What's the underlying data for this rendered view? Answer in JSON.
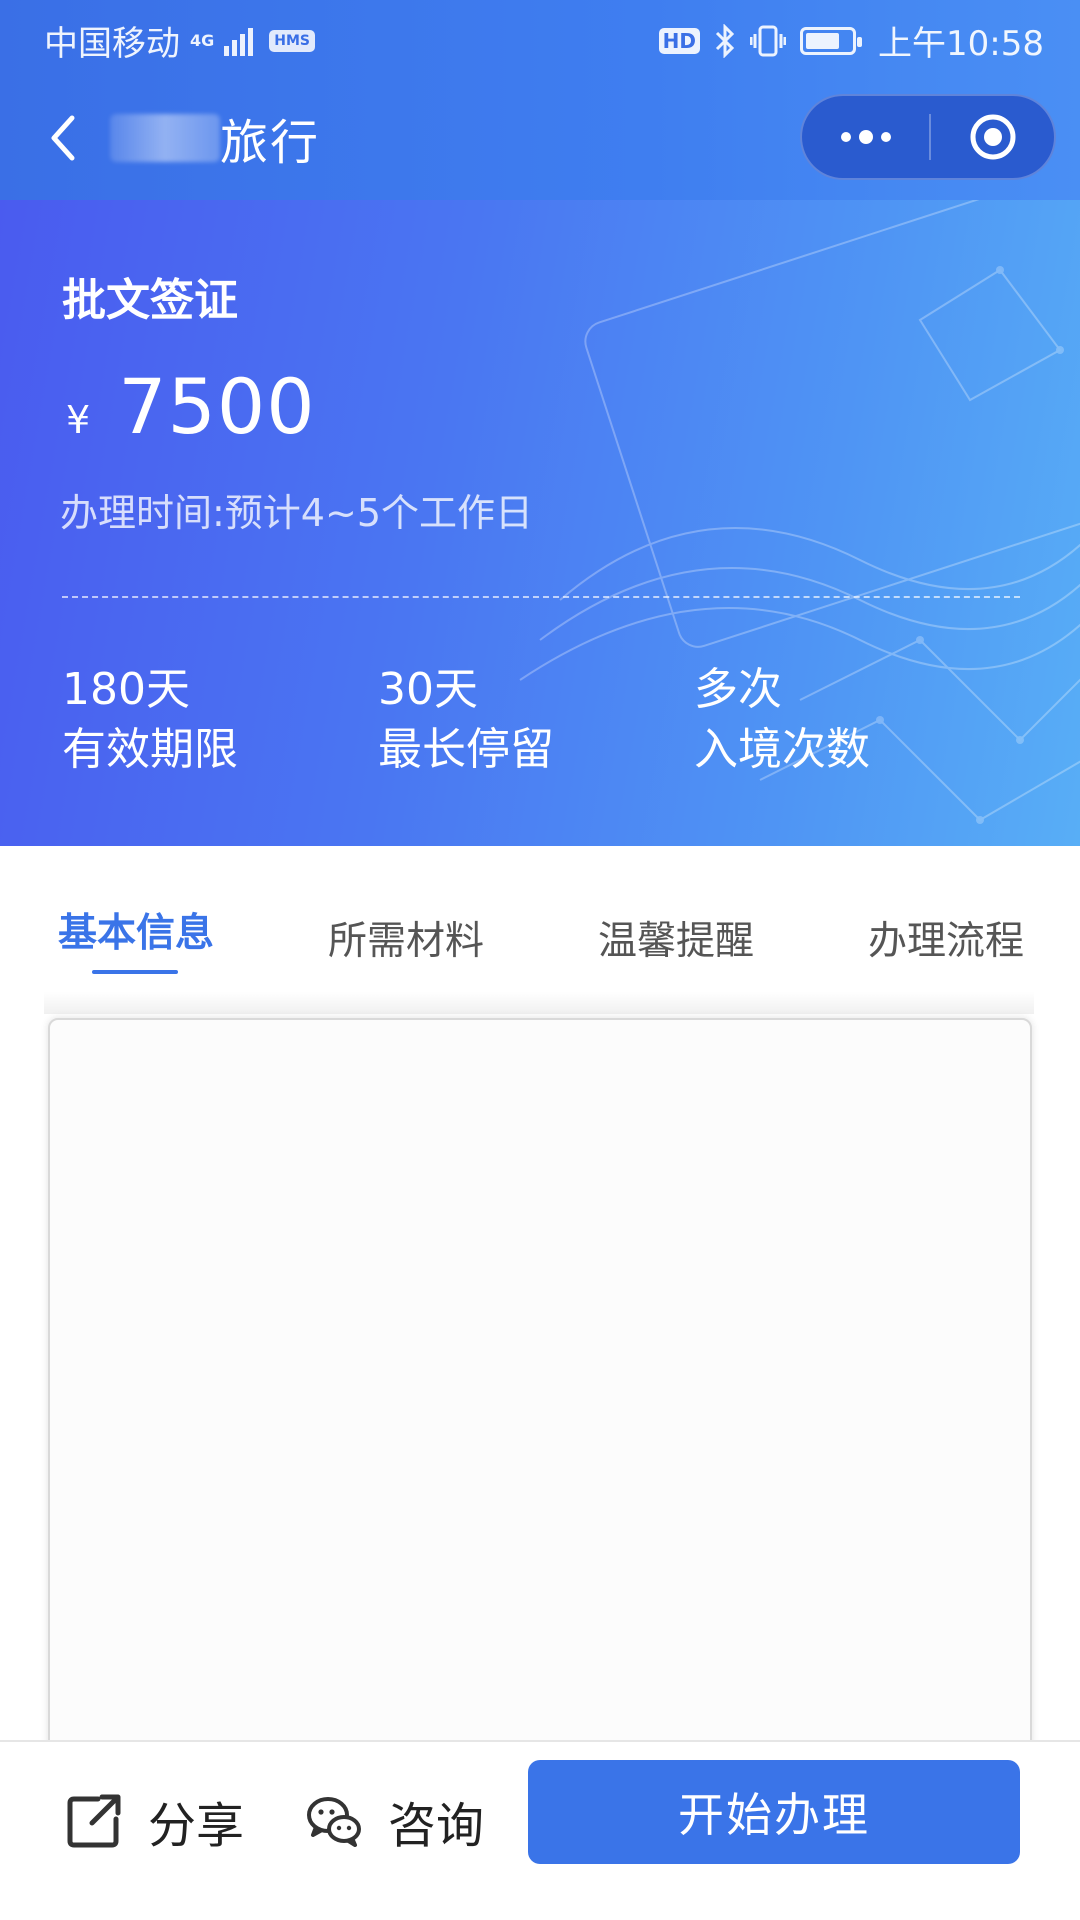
{
  "status_bar": {
    "carrier": "中国移动",
    "network": "4G",
    "hms_tag": "HMS",
    "hd_tag": "HD",
    "time": "上午10:58",
    "battery_percent": 75
  },
  "nav": {
    "title_suffix": "旅行"
  },
  "banner": {
    "visa_name": "批文签证",
    "currency": "¥",
    "price": "7500",
    "processing_time": "办理时间:预计4~5个工作日",
    "stats": [
      {
        "value": "180天",
        "label": "有效期限"
      },
      {
        "value": "30天",
        "label": "最长停留"
      },
      {
        "value": "多次",
        "label": "入境次数"
      }
    ]
  },
  "tabs": [
    {
      "label": "基本信息",
      "active": true
    },
    {
      "label": "所需材料",
      "active": false
    },
    {
      "label": "温馨提醒",
      "active": false
    },
    {
      "label": "办理流程",
      "active": false
    }
  ],
  "bottom_bar": {
    "share_label": "分享",
    "consult_label": "咨询",
    "start_label": "开始办理"
  },
  "colors": {
    "brand_blue": "#3a74e8",
    "banner_gradient_start": "#4a5bef",
    "banner_gradient_end": "#58aef6"
  },
  "icons": {
    "back": "chevron-left-icon",
    "more": "more-dots-icon",
    "close_target": "target-circle-icon",
    "share": "share-external-icon",
    "consult": "wechat-chat-icon"
  }
}
